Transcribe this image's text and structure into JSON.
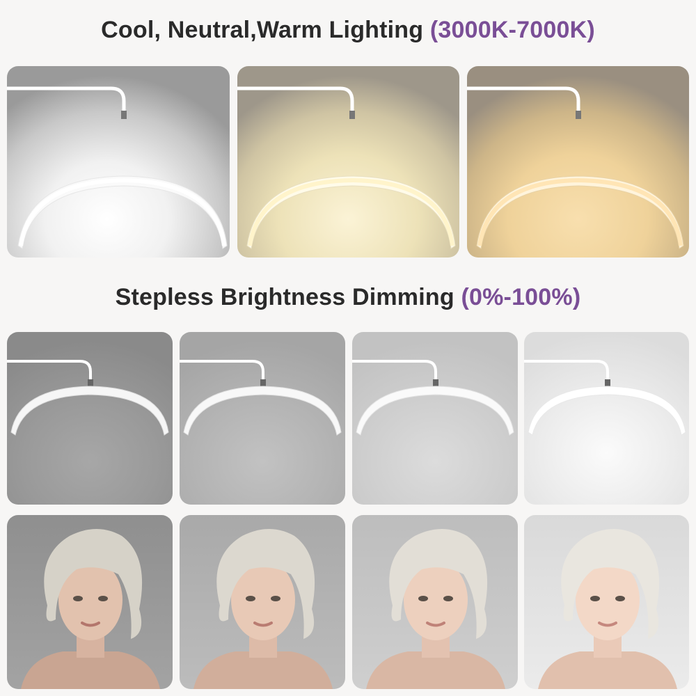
{
  "headings": {
    "temperature": {
      "main": "Cool, Neutral,Warm Lighting",
      "accent": "(3000K-7000K)"
    },
    "brightness": {
      "main": "Stepless Brightness Dimming",
      "accent": "(0%-100%)"
    }
  },
  "colors": {
    "heading_text": "#2a2a2a",
    "accent": "#7a4e96"
  },
  "temperature_panels": [
    {
      "label": "cool",
      "glow": "#ffffff"
    },
    {
      "label": "neutral",
      "glow": "#f5e7b5"
    },
    {
      "label": "warm",
      "glow": "#f2cf92"
    }
  ],
  "brightness_levels": [
    0.25,
    0.5,
    0.75,
    1.0
  ]
}
